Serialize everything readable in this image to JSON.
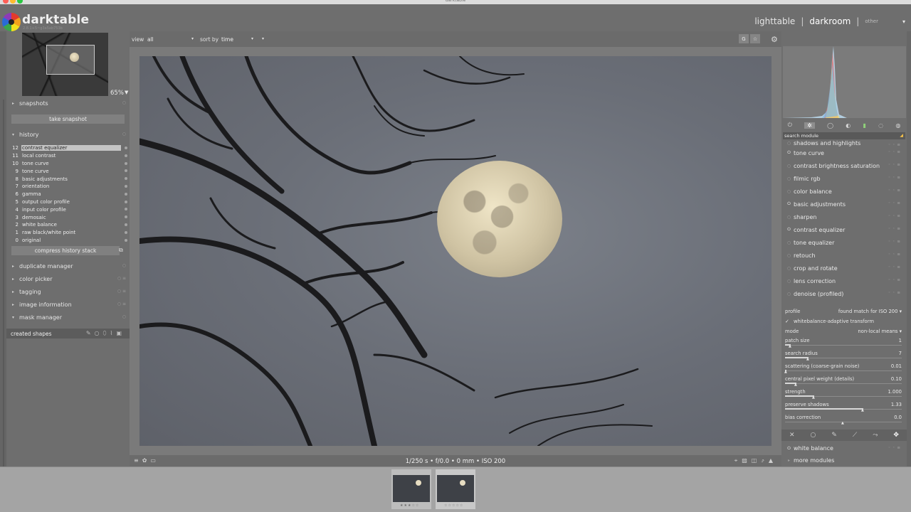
{
  "window": {
    "title": "darktable",
    "traffic_lights": [
      "#fe5f57",
      "#febc2e",
      "#28c840"
    ]
  },
  "header": {
    "app_name": "darktable",
    "version": "2.8.1+5~g3a5ab753b",
    "views": {
      "lighttable": "lighttable",
      "separator": "|",
      "darkroom": "darkroom",
      "other": "other"
    }
  },
  "navigation": {
    "zoom": "65%"
  },
  "left_panel": {
    "snapshots": {
      "title": "snapshots",
      "take_snapshot": "take snapshot"
    },
    "history": {
      "title": "history",
      "items": [
        {
          "num": "12",
          "label": "contrast equalizer",
          "selected": true
        },
        {
          "num": "11",
          "label": "local contrast"
        },
        {
          "num": "10",
          "label": "tone curve"
        },
        {
          "num": "9",
          "label": "tone curve"
        },
        {
          "num": "8",
          "label": "basic adjustments"
        },
        {
          "num": "7",
          "label": "orientation"
        },
        {
          "num": "6",
          "label": "gamma"
        },
        {
          "num": "5",
          "label": "output color profile"
        },
        {
          "num": "4",
          "label": "input color profile"
        },
        {
          "num": "3",
          "label": "demosaic"
        },
        {
          "num": "2",
          "label": "white balance"
        },
        {
          "num": "1",
          "label": "raw black/white point"
        },
        {
          "num": "0",
          "label": "original"
        }
      ],
      "compress": "compress history stack"
    },
    "modules": [
      "duplicate manager",
      "color picker",
      "tagging",
      "image information",
      "mask manager"
    ],
    "created_shapes": "created shapes"
  },
  "filter_bar": {
    "view_label": "view",
    "view_value": "all",
    "sort_label": "sort by",
    "sort_value": "time"
  },
  "top_icons": {
    "g": "G",
    "star": "☆"
  },
  "image_info": "1/250 s • f/0.0 • 0 mm • ISO 200",
  "right_panel": {
    "search_placeholder": "search module",
    "modules": [
      {
        "name": "shadows and highlights",
        "on": false
      },
      {
        "name": "tone curve",
        "on": true
      },
      {
        "name": "contrast brightness saturation",
        "on": false
      },
      {
        "name": "filmic rgb",
        "on": false
      },
      {
        "name": "color balance",
        "on": false
      },
      {
        "name": "basic adjustments",
        "on": true
      },
      {
        "name": "sharpen",
        "on": false
      },
      {
        "name": "contrast equalizer",
        "on": true
      },
      {
        "name": "tone equalizer",
        "on": false
      },
      {
        "name": "retouch",
        "on": false
      },
      {
        "name": "crop and rotate",
        "on": false
      },
      {
        "name": "lens correction",
        "on": false
      },
      {
        "name": "denoise (profiled)",
        "on": false
      }
    ],
    "denoise": {
      "profile_label": "profile",
      "profile_value": "found match for ISO 200",
      "wb_adaptive": "whitebalance-adaptive transform",
      "mode_label": "mode",
      "mode_value": "non-local means",
      "params": [
        {
          "label": "patch size",
          "value": "1",
          "level": 0.05
        },
        {
          "label": "search radius",
          "value": "7",
          "level": 0.2
        },
        {
          "label": "scattering (coarse-grain noise)",
          "value": "0.01",
          "level": 0.01
        },
        {
          "label": "central pixel weight (details)",
          "value": "0.10",
          "level": 0.1
        },
        {
          "label": "strength",
          "value": "1.000",
          "level": 0.25
        },
        {
          "label": "preserve shadows",
          "value": "1.33",
          "level": 0.67
        },
        {
          "label": "bias correction",
          "value": "0.0",
          "level": 0.5
        }
      ]
    },
    "bottom_modules": [
      {
        "name": "white balance",
        "on": true
      },
      {
        "name": "more modules",
        "on": false
      }
    ]
  },
  "filmstrip": {
    "count": 2
  }
}
